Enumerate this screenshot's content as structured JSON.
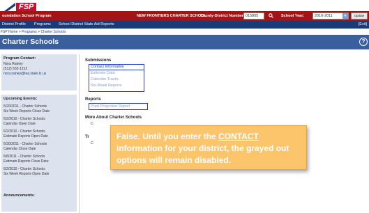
{
  "header": {
    "logo_text": "FSP",
    "program_name": "oundation School Program",
    "school_name": "NEW FRONTIERS CHARTER SCHOOL",
    "county_district_label": "County-District Number:",
    "county_district_value": "015805",
    "school_year_label": "School Year:",
    "school_year_value": "2010-2011",
    "update_label": "Update"
  },
  "nav": {
    "items": [
      "District Profile",
      "Programs",
      "School District State Aid Reports"
    ],
    "exit_label": "[Exit]"
  },
  "breadcrumb": {
    "items": [
      "FSP Home",
      "Programs",
      "Charter Schools"
    ],
    "separator": ">"
  },
  "page": {
    "title": "Charter Schools",
    "help_symbol": "?"
  },
  "sidebar": {
    "contact_heading": "Program Contact:",
    "contact_name": "Nora Rainey",
    "contact_phone": "(512) 555-1212",
    "contact_email": "nora.rainey@tea.state.tx.us",
    "events_heading": "Upcoming Events:",
    "events": [
      {
        "date": "6/20/2011 - Charter Schools",
        "desc": "Six Week Reports Close Date"
      },
      {
        "date": "6/2/2010 - Charter Schools",
        "desc": "Calendar Open Date"
      },
      {
        "date": "6/2/2010 - Charter Schools",
        "desc": "Estimate Reports Open Date"
      },
      {
        "date": "6/30/2011 - Charter Schools",
        "desc": "Calendar Close Date"
      },
      {
        "date": "6/8/2011 - Charter Schools",
        "desc": "Estimate Reports Close Date"
      },
      {
        "date": "6/2/2010 - Charter Schools",
        "desc": "Six Week Reports Open Date"
      }
    ],
    "announcements_heading": "Announcements:"
  },
  "main": {
    "submissions_heading": "Submissions",
    "submission_links": [
      "Contact Information",
      "Estimate Data",
      "Calendar Tracks",
      "Six-Week Reports"
    ],
    "reports_heading": "Reports",
    "report_links": [
      "Pupil Projection Report"
    ],
    "more_heading": "More About Charter Schools",
    "more_link_partial": "C",
    "training_heading_partial": "Tr",
    "training_link_partial": "C"
  },
  "callout": {
    "text_before": "False. Until you enter the ",
    "text_emph": "CONTACT",
    "text_after": " information for your district, the grayed out options will remain disabled."
  },
  "colors": {
    "brand_red": "#a31515",
    "nav_blue": "#1b3a78",
    "title_blue": "#3a5f9e",
    "highlight_border": "#2a3bd6",
    "callout_bg": "#fcc56b"
  }
}
